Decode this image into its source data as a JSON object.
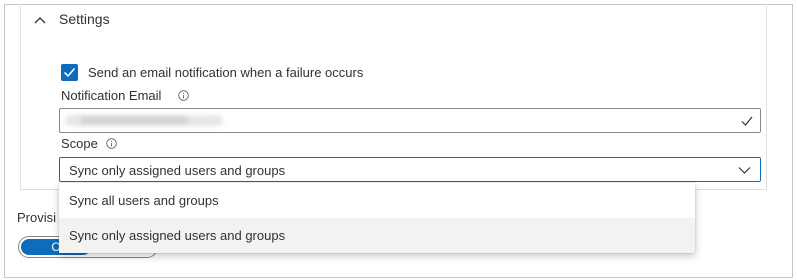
{
  "settings": {
    "section_title": "Settings",
    "email_notification_label": "Send an email notification when a failure occurs",
    "email_notification_checked": true,
    "notification_email_label": "Notification Email",
    "notification_email_value": "",
    "scope_label": "Scope",
    "scope_selected": "Sync only assigned users and groups"
  },
  "scope_dropdown": {
    "options": [
      "Sync all users and groups",
      "Sync only assigned users and groups"
    ],
    "selected_index": 1
  },
  "provisioning": {
    "label_partial": "Provisi",
    "toggle_on_label": "O"
  },
  "colors": {
    "accent": "#0f6cbd",
    "border": "#8a8886",
    "selected_bg": "#f3f2f1"
  },
  "icons": [
    "chevron-up-icon",
    "checkmark-icon",
    "info-icon",
    "chevron-down-icon"
  ]
}
